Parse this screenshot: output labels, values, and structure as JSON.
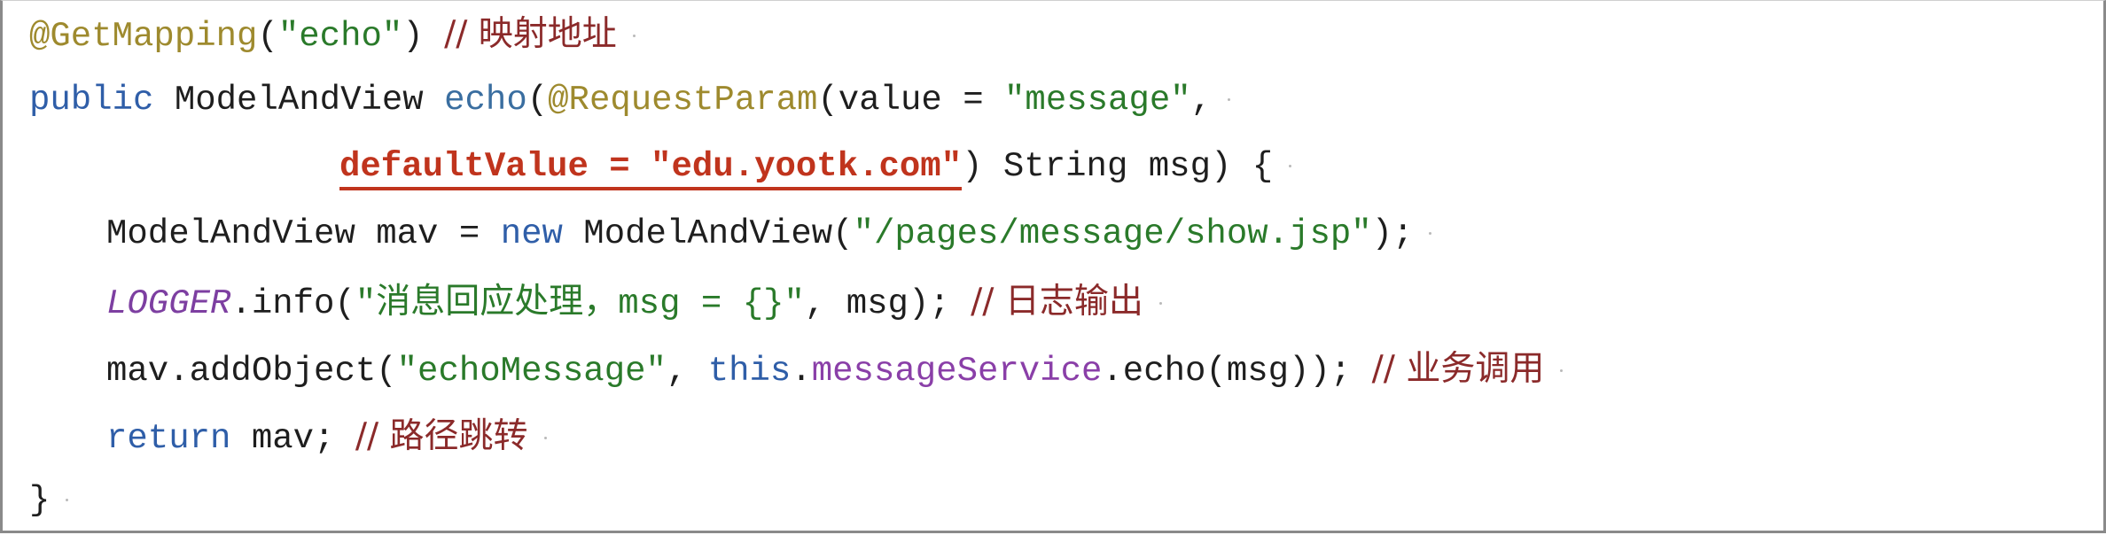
{
  "code": {
    "line1": {
      "annotation": "@GetMapping",
      "open": "(",
      "path": "\"echo\"",
      "close": ") ",
      "comment": "// 映射地址"
    },
    "line2": {
      "kw_public": "public",
      "sp1": " ",
      "type": "ModelAndView",
      "sp2": " ",
      "method": "echo",
      "open": "(",
      "annotation": "@RequestParam",
      "param_open": "(value = ",
      "value_str": "\"message\"",
      "comma": ","
    },
    "line3": {
      "default_value": "defaultValue = \"edu.yootk.com\"",
      "rest": ") String msg) {"
    },
    "line4": {
      "decl": "ModelAndView mav = ",
      "kw_new": "new",
      "ctor": " ModelAndView(",
      "path_str": "\"/pages/message/show.jsp\"",
      "end": ");"
    },
    "line5": {
      "logger": "LOGGER",
      "call": ".info(",
      "msg_str": "\"消息回应处理，msg = {}\"",
      "args": ", msg); ",
      "comment": "// 日志输出"
    },
    "line6": {
      "call": "mav.addObject(",
      "key_str": "\"echoMessage\"",
      "comma": ", ",
      "kw_this": "this",
      "dot": ".",
      "field": "messageService",
      "rest": ".echo(msg)); ",
      "comment": "// 业务调用"
    },
    "line7": {
      "kw_return": "return",
      "rest": " mav; ",
      "comment": "// 路径跳转"
    },
    "line8": {
      "brace": "}"
    }
  },
  "colors": {
    "annotation": "#9e8a2e",
    "keyword": "#2f5ea8",
    "string": "#2a7a2a",
    "comment": "#8b2a2a",
    "static_field": "#7d3fa1",
    "highlight": "#c0341d"
  }
}
